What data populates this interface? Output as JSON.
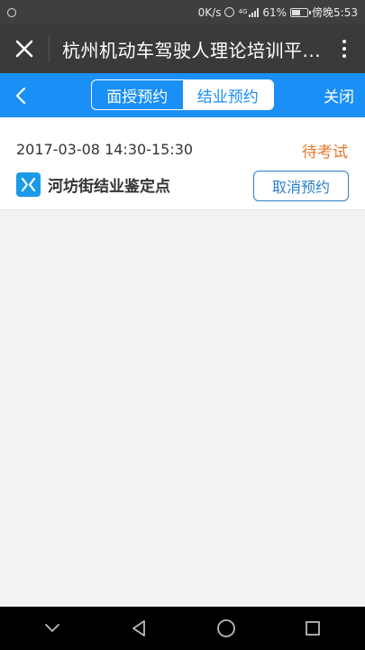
{
  "status_bar": {
    "net_speed": "0K/s",
    "signal_label": "4G",
    "battery_percent": "61%",
    "battery_level": 0.61,
    "time": "傍晚5:53"
  },
  "title_bar": {
    "title": "杭州机动车驾驶人理论培训平..."
  },
  "nav": {
    "tabs": [
      {
        "label": "面授预约",
        "active": false
      },
      {
        "label": "结业预约",
        "active": true
      }
    ],
    "close_label": "关闭"
  },
  "appointment": {
    "datetime": "2017-03-08 14:30-15:30",
    "status": "待考试",
    "site_name": "河坊街结业鉴定点",
    "cancel_label": "取消预约"
  },
  "colors": {
    "accent": "#1a8ff5",
    "status_orange": "#e7772a"
  }
}
